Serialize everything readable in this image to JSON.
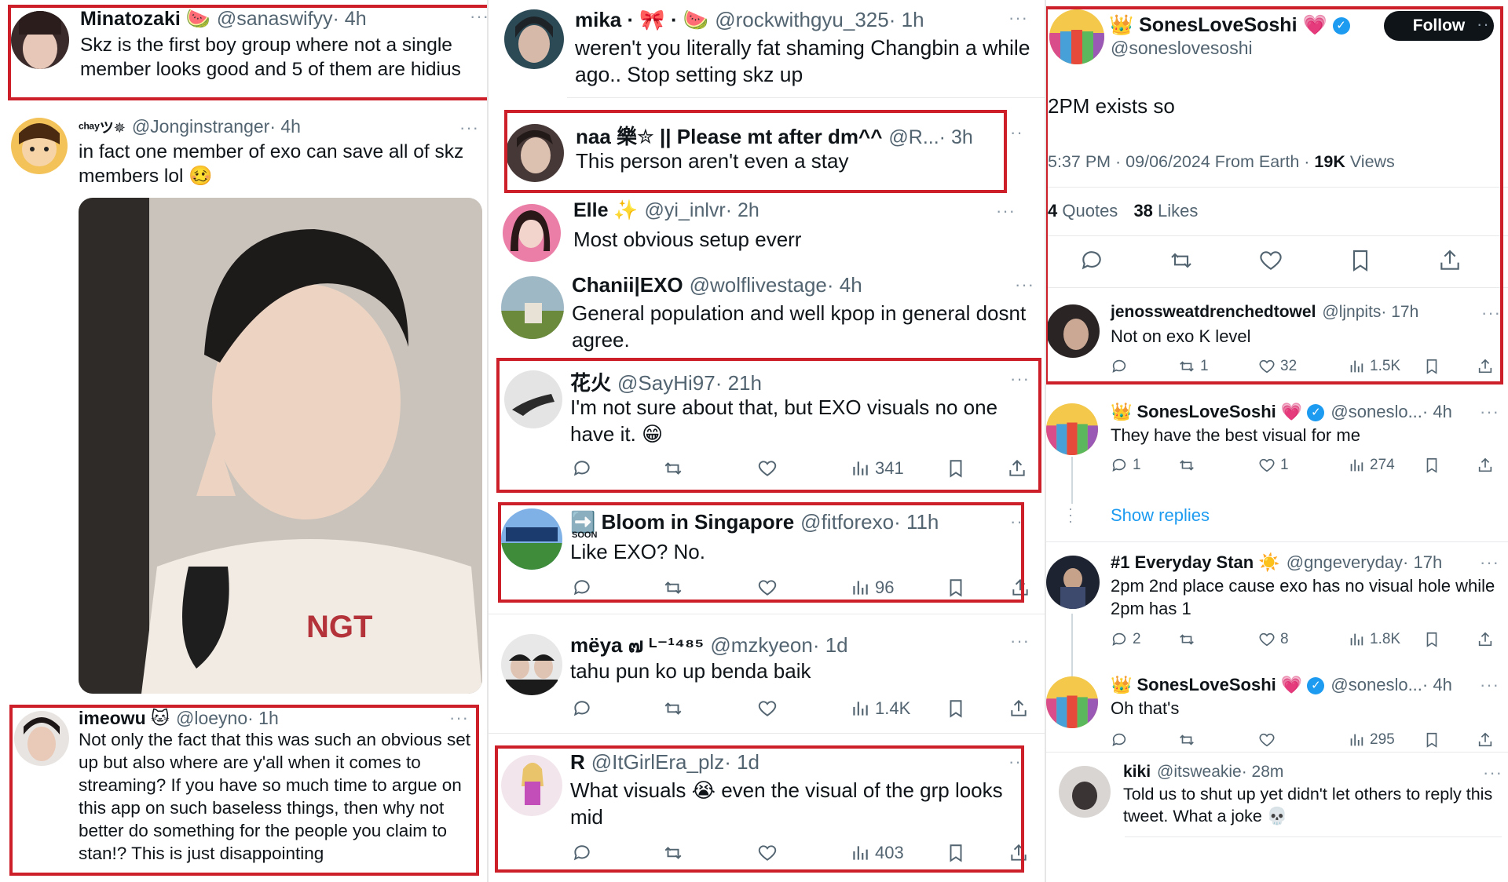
{
  "col1": {
    "t1": {
      "name": "Minatozaki 🍉",
      "handle": "@sanaswifyy",
      "time": "· 4h",
      "text": "Skz is the first boy group where not a single member looks good and 5 of them are hidius"
    },
    "t2": {
      "name": "ᶜʰᵃʸツ✵",
      "handle": "@Jonginstranger",
      "time": "· 4h",
      "text": "in fact one member of exo can save all of skz members lol 🥴"
    },
    "photo": {
      "shirt_text": "NGT"
    },
    "t3": {
      "name": "imeowu 🐱",
      "handle": "@loeyno",
      "time": "· 1h",
      "text": "Not only the fact that this was such an obvious set up but also where are y'all when it comes to streaming? If you have so much time to argue on this app on such baseless things, then why not better do something for the people you claim to stan!? This is just disappointing"
    }
  },
  "col2": {
    "t1": {
      "name": "mika · 🎀 · 🍉",
      "handle": "@rockwithgyu_325",
      "time": "· 1h",
      "text": "weren't you literally fat shaming Changbin a while ago.. Stop setting skz up"
    },
    "t2": {
      "name": "naa 樂✮ || Please mt after dm^^",
      "handle": "@R...",
      "time": "· 3h",
      "text": "This person aren't even a stay"
    },
    "t3": {
      "name": "Elle ✨",
      "handle": "@yi_inlvr",
      "time": "· 2h",
      "text": "Most obvious setup everr"
    },
    "t4": {
      "name": "Chanii|EXO",
      "handle": "@wolflivestage",
      "time": "· 4h",
      "text": "General population and well kpop in general dosnt agree."
    },
    "t5": {
      "name": "花火",
      "handle": "@SayHi97",
      "time": "· 21h",
      "text": "I'm not sure about that, but EXO visuals no one have it. 😁",
      "views": "341"
    },
    "t6": {
      "name": "➡️ Bloom in Singapore",
      "handle": "@fitforexo",
      "time": "· 11h",
      "text": "Like EXO? No.",
      "views": "96",
      "soon": "SOON"
    },
    "t7": {
      "name": "mëya ๗ ᴸ⁻¹⁴⁸⁵",
      "handle": "@mzkyeon",
      "time": "· 1d",
      "text": "tahu pun ko up benda baik",
      "views": "1.4K"
    },
    "t8": {
      "name": "R",
      "handle": "@ItGirlEra_plz",
      "time": "· 1d",
      "text": "What visuals 😭 even the visual of the grp looks mid",
      "views": "403"
    }
  },
  "col3": {
    "main": {
      "name": "👑 SonesLoveSoshi 💗",
      "handle": "@soneslovesoshi",
      "follow": "Follow",
      "text": "2PM exists so",
      "meta": "5:37 PM · 09/06/2024 From Earth ·",
      "views_count": "19K",
      "views_label": "Views",
      "quotes_count": "4",
      "quotes_label": "Quotes",
      "likes_count": "38",
      "likes_label": "Likes"
    },
    "r1": {
      "name": "jenossweatdrenchedtowel",
      "handle": "@ljnpits",
      "time": "· 17h",
      "text": "Not on exo K level",
      "retweets": "1",
      "likes": "32",
      "views": "1.5K"
    },
    "r2": {
      "name": "👑 SonesLoveSoshi 💗",
      "handle": "@soneslo...",
      "time": "· 4h",
      "text": "They have the best visual for me",
      "replies": "1",
      "likes": "1",
      "views": "274"
    },
    "show_replies": "Show replies",
    "r3": {
      "name": "#1 Everyday Stan ☀️",
      "handle": "@gngeveryday",
      "time": "· 17h",
      "text": "2pm 2nd place cause exo has no visual hole while 2pm has 1",
      "replies": "2",
      "likes": "8",
      "views": "1.8K"
    },
    "r4": {
      "name": "👑 SonesLoveSoshi 💗",
      "handle": "@soneslo...",
      "time": "· 4h",
      "text": "Oh that's",
      "views": "295"
    },
    "r5": {
      "name": "kiki",
      "handle": "@itsweakie",
      "time": "· 28m",
      "text": "Told us to shut up yet didn't let others to reply this tweet. What a joke 💀"
    }
  },
  "icons": {
    "reply": "reply-icon",
    "retweet": "retweet-icon",
    "like": "heart-icon",
    "views": "views-icon",
    "bookmark": "bookmark-icon",
    "share": "share-icon"
  },
  "colors": {
    "highlight": "#cc1f2a",
    "link": "#1d9bf0",
    "verified": "#1d9bf0"
  }
}
